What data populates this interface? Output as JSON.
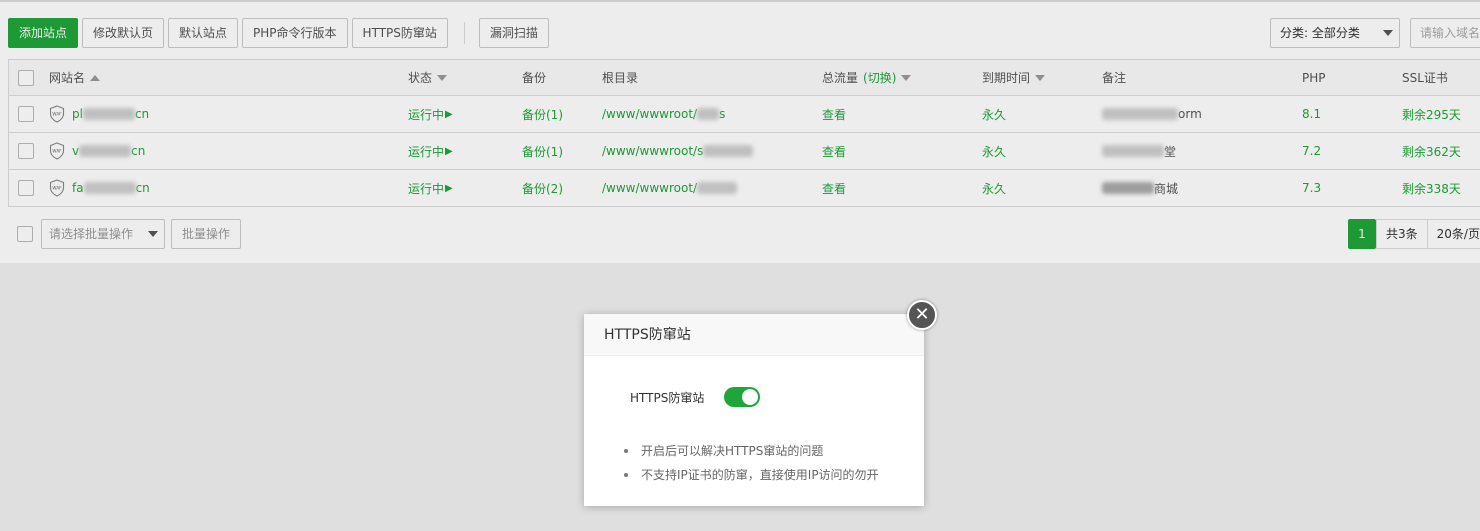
{
  "toolbar": {
    "buttons": [
      "添加站点",
      "修改默认页",
      "默认站点",
      "PHP命令行版本",
      "HTTPS防窜站",
      "漏洞扫描"
    ],
    "category_select": "分类: 全部分类",
    "search_placeholder": "请输入域名"
  },
  "table": {
    "headers": {
      "site": "网站名",
      "status": "状态",
      "backup": "备份",
      "root": "根目录",
      "traffic": "总流量",
      "traffic_switch": "(切换)",
      "expire": "到期时间",
      "remark": "备注",
      "php": "PHP",
      "ssl": "SSL证书"
    },
    "rows": [
      {
        "site_prefix": "pl",
        "site_suffix": "cn",
        "status": "运行中",
        "backup": "备份(1)",
        "root": "/www/wwwroot/",
        "root_tail": "s",
        "traffic": "查看",
        "expire": "永久",
        "remark_tail": "orm",
        "php": "8.1",
        "ssl": "剩余295天"
      },
      {
        "site_prefix": "v",
        "site_suffix": "cn",
        "status": "运行中",
        "backup": "备份(1)",
        "root": "/www/wwwroot/s",
        "root_tail": "",
        "traffic": "查看",
        "expire": "永久",
        "remark_tail": "堂",
        "php": "7.2",
        "ssl": "剩余362天"
      },
      {
        "site_prefix": "fa",
        "site_suffix": "cn",
        "status": "运行中",
        "backup": "备份(2)",
        "root": "/www/wwwroot/",
        "root_tail": "",
        "traffic": "查看",
        "expire": "永久",
        "remark_tail": "商城",
        "php": "7.3",
        "ssl": "剩余338天"
      }
    ]
  },
  "batch": {
    "select_placeholder": "请选择批量操作",
    "button": "批量操作"
  },
  "pagination": {
    "current": "1",
    "total": "共3条",
    "per_page": "20条/页"
  },
  "modal": {
    "title": "HTTPS防窜站",
    "close_symbol": "✕",
    "option_label": "HTTPS防窜站",
    "toggle_on": true,
    "notes": [
      "开启后可以解决HTTPS窜站的问题",
      "不支持IP证书的防窜，直接使用IP访问的勿开"
    ]
  },
  "icons": {
    "site": "waf-shield-icon",
    "close": "close-icon"
  },
  "colors": {
    "accent": "#20a53a"
  }
}
